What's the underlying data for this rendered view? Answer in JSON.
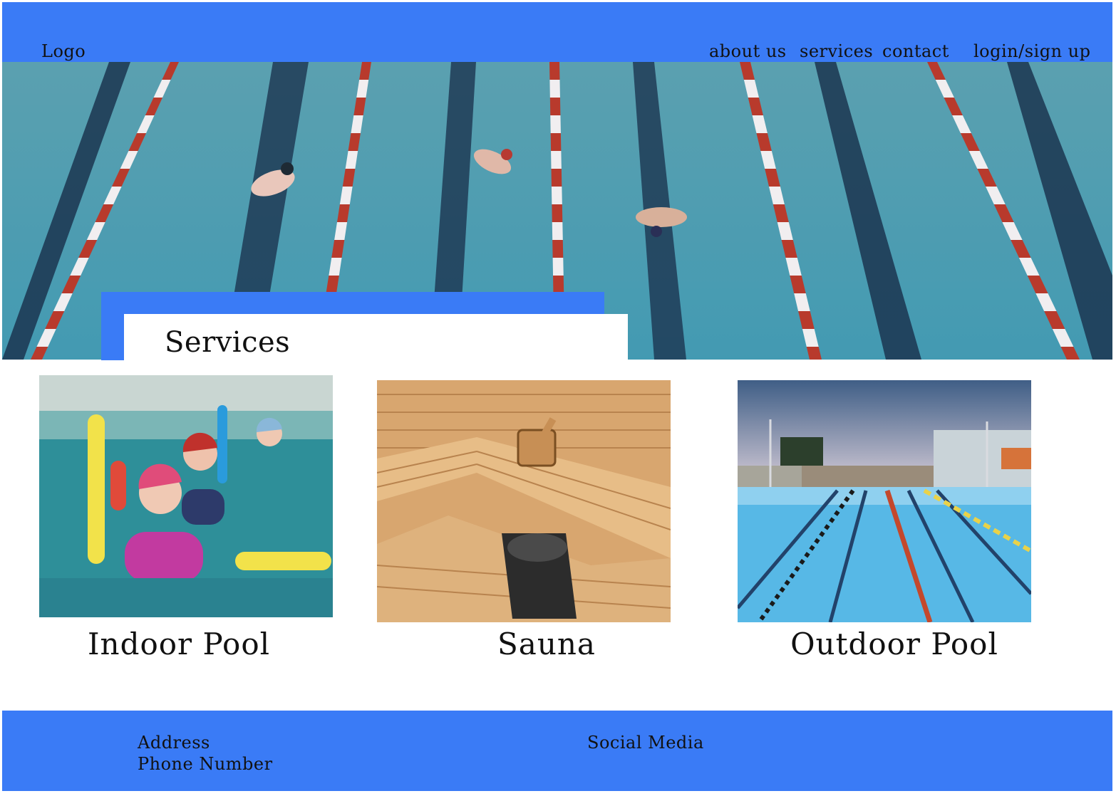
{
  "header": {
    "logo": "Logo",
    "nav": [
      "about us",
      "services",
      "contact",
      "login/sign up"
    ]
  },
  "hero": {
    "image": "swimming-pool-lanes-photo"
  },
  "services": {
    "title": "Services",
    "cards": [
      {
        "label": "Indoor Pool",
        "image": "aqua-fitness-photo"
      },
      {
        "label": "Sauna",
        "image": "wooden-sauna-photo"
      },
      {
        "label": "Outdoor Pool",
        "image": "outdoor-pool-photo"
      }
    ]
  },
  "footer": {
    "address": "Address",
    "phone": "Phone Number",
    "social": "Social Media"
  },
  "colors": {
    "accent": "#3a7bf6",
    "background": "#ffffff"
  }
}
